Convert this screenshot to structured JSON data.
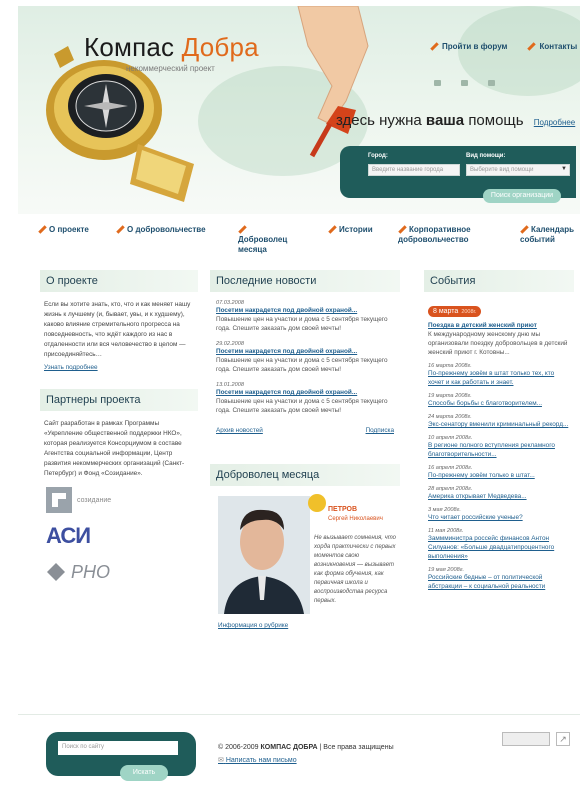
{
  "header": {
    "logo_main": "Компас",
    "logo_accent": "Добра",
    "tagline": "некоммерческий проект",
    "links": [
      "Пройти в форум",
      "Контакты"
    ],
    "need_prefix": "здесь нужна",
    "need_bold": "ваша",
    "need_suffix": "помощь",
    "need_more": "Подробнее",
    "city_label": "Город:",
    "city_placeholder": "Введите название города",
    "help_label": "Вид помощи:",
    "help_placeholder": "Выберите вид помощи",
    "search_button": "Поиск организации"
  },
  "nav": [
    "О проекте",
    "О добровольчестве",
    "Доброволец месяца",
    "Истории",
    "Корпоративное добровольчество",
    "Календарь событий"
  ],
  "about": {
    "title": "О проекте",
    "text": "Если вы хотите знать, кто, что и как меняет нашу жизнь к лучшему (и, бывает, увы, и к худшему), каково влияние стремительного прогресса на повседневность, что ждёт каждого из нас в отдаленности или вся человечество в целом — присоединяйтесь…",
    "more": "Узнать подробнее"
  },
  "partners": {
    "title": "Партнеры проекта",
    "text": "Сайт разработан в рамках Программы «Укрепление общественной поддержки НКО», которая реализуется Консорциумом в составе Агентства социальной информации, Центр развития некоммерческих организаций (Санкт-Петербург) и Фонд «Созидание».",
    "logos": [
      "созидание",
      "АСИ",
      "РНО"
    ]
  },
  "news": {
    "title": "Последние новости",
    "items": [
      {
        "date": "07.03.2008",
        "head": "Посетим накрадется под двойной охраной...",
        "body": "Повышение цен на участки и дома с 5 сентября текущего года. Спешите заказать дом своей мечты!"
      },
      {
        "date": "29.02.2008",
        "head": "Посетим накрадется под двойной охраной...",
        "body": "Повышение цен на участки и дома с 5 сентября текущего года. Спешите заказать дом своей мечты!"
      },
      {
        "date": "13.01.2008",
        "head": "Посетим накрадется под двойной охраной...",
        "body": "Повышение цен на участки и дома с 5 сентября текущего года. Спешите заказать дом своей мечты!"
      }
    ],
    "archive": "Архив новостей",
    "subscribe": "Подписка"
  },
  "volunteer": {
    "title": "Доброволец месяца",
    "name_label": "ПЕТРОВ",
    "name_full": "Сергей Николаевич",
    "quote": "Не вызывает сомнения, что хорда практически с первых моментов свою возникновения — вызывает как форма обучения, как первичная школа и воспроизводства ресурса первых.",
    "info_link": "Информация о рубрике"
  },
  "events": {
    "title": "События",
    "badge_date": "8 марта",
    "badge_year": "2008г.",
    "first_head": "Поездка в детский женский приют",
    "first_body": "К международному женскому дню мы организовали поездку добровольцев в детский женский приют г. Котовны...",
    "items": [
      {
        "date": "16 марта 2008г.",
        "link": "По-прежнему зовём в штат только тех, кто хочет и как работать и знает."
      },
      {
        "date": "19 марта 2008г.",
        "link": "Способы борьбы с благотворителем..."
      },
      {
        "date": "24 марта 2008г.",
        "link": "Экс-сенатору вменили криминальный рекорд..."
      },
      {
        "date": "10 апреля 2008г.",
        "link": "В регионе полного вступления рекламного благотворительности..."
      },
      {
        "date": "16 апреля 2008г.",
        "link": "По-прежнему зовём только в штат..."
      },
      {
        "date": "28 апреля 2008г.",
        "link": "Америка открывает Медведева..."
      },
      {
        "date": "3 мая 2008г.",
        "link": "Что читает российские ученые?"
      },
      {
        "date": "11 мая 2008г.",
        "link": "Заммминистра россейс финансов Антон Силуанов: «Больше двадцатипроцентного выполнения»"
      },
      {
        "date": "19 мая 2008г.",
        "link": "Российские бедные – от политической абстракции – к социальной реальности"
      }
    ]
  },
  "footer": {
    "search_placeholder": "Поиск по сайту",
    "search_button": "Искать",
    "copyright_prefix": "© 2006-2009",
    "copyright_brand": "КОМПАС ДОБРА",
    "copyright_suffix": "| Все права защищены",
    "mail_link": "Написать нам письмо"
  },
  "colors": {
    "accent": "#e06a1c",
    "teal": "#1f5c5a",
    "link": "#1f5f8e"
  }
}
